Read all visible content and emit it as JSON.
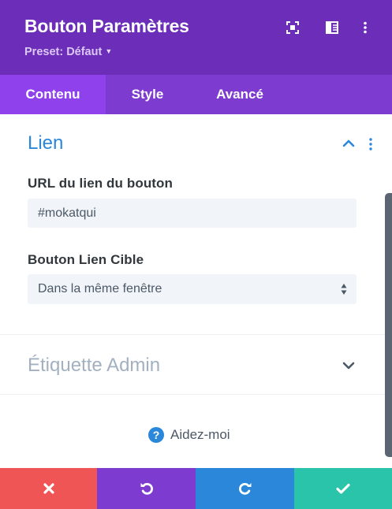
{
  "header": {
    "title": "Bouton Paramètres",
    "preset_label": "Preset: Défaut",
    "icons": [
      "expand-icon",
      "split-layout-icon",
      "more-vertical-icon"
    ]
  },
  "tabs": [
    {
      "label": "Contenu",
      "active": true
    },
    {
      "label": "Style",
      "active": false
    },
    {
      "label": "Avancé",
      "active": false
    }
  ],
  "sections": {
    "lien": {
      "title": "Lien",
      "expanded": true,
      "fields": {
        "url_label": "URL du lien du bouton",
        "url_value": "#mokatqui",
        "target_label": "Bouton Lien Cible",
        "target_value": "Dans la même fenêtre"
      }
    },
    "admin": {
      "title": "Étiquette Admin",
      "expanded": false
    }
  },
  "help": {
    "label": "Aidez-moi",
    "icon": "question-icon"
  },
  "footer": {
    "buttons": [
      {
        "name": "cancel",
        "icon": "close-icon",
        "color": "#ef5555"
      },
      {
        "name": "undo",
        "icon": "undo-icon",
        "color": "#7e3bd0"
      },
      {
        "name": "redo",
        "icon": "redo-icon",
        "color": "#2b87da"
      },
      {
        "name": "save",
        "icon": "check-icon",
        "color": "#29c4a9"
      }
    ]
  },
  "colors": {
    "header_bg": "#6c2eb9",
    "tabs_bg": "#7d3bcf",
    "active_tab_bg": "#8f42ec",
    "accent_blue": "#2b87da"
  }
}
